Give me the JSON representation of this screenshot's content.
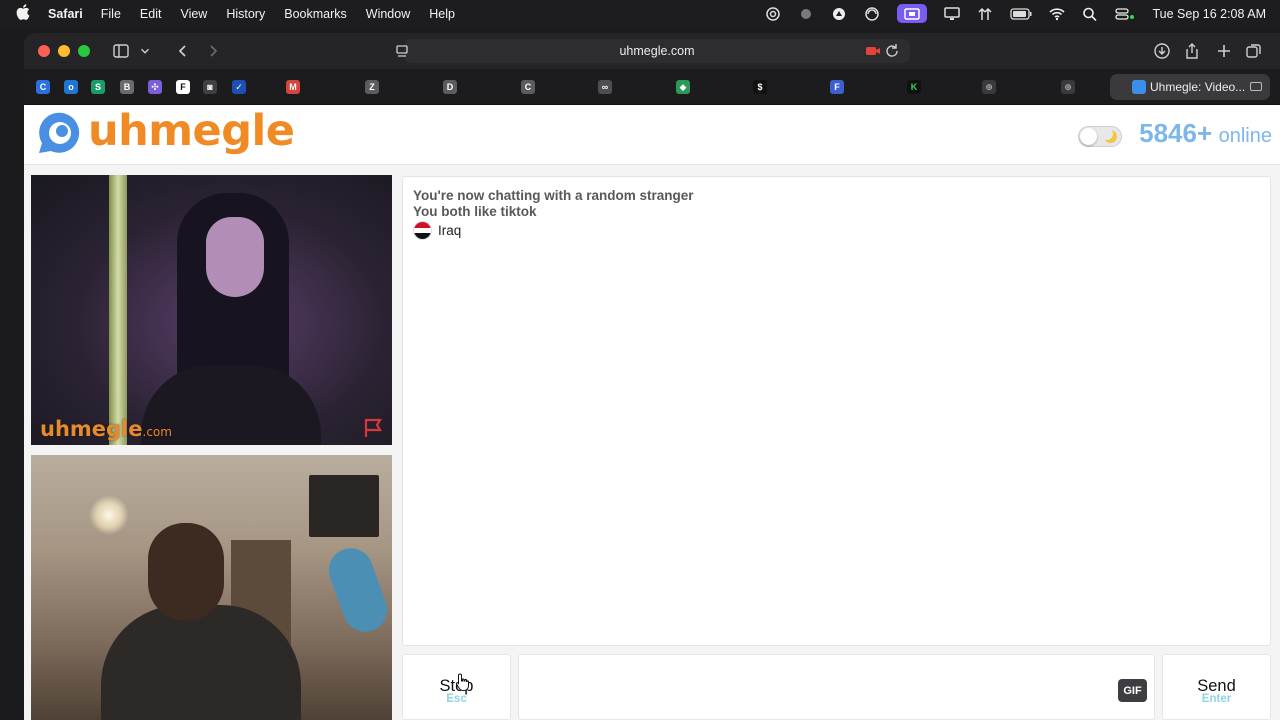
{
  "menubar": {
    "app_name": "Safari",
    "menus": [
      "File",
      "Edit",
      "View",
      "History",
      "Bookmarks",
      "Window",
      "Help"
    ],
    "clock": "Tue Sep 16  2:08 AM",
    "status_icons": [
      "creative-cloud-icon",
      "record-dot-icon",
      "drive-icon",
      "sync-icon",
      "screen-share-icon",
      "display-icon",
      "arrows-icon",
      "battery-icon",
      "wifi-icon",
      "spotlight-search-icon",
      "control-center-icon"
    ],
    "active_color": "#7b5cf3"
  },
  "browser": {
    "url": "uhmegle.com",
    "active_tab_title": "Uhmegle: Video...",
    "bookmark_favicons": [
      {
        "name": "c-favicon",
        "letter": "C",
        "color": "#2d6fe0"
      },
      {
        "name": "outlook-favicon",
        "letter": "o",
        "color": "#1f75d4"
      },
      {
        "name": "s-favicon",
        "letter": "S",
        "color": "#1a9d6b"
      },
      {
        "name": "b-favicon",
        "letter": "B",
        "color": "#6a6a6e"
      },
      {
        "name": "grid-favicon",
        "letter": "✣",
        "color": "#7a5fd8"
      },
      {
        "name": "f-favicon",
        "letter": "F",
        "color": "#ffffff"
      },
      {
        "name": "camera-favicon",
        "letter": "◙",
        "color": "#404044"
      },
      {
        "name": "blue-check-favicon",
        "letter": "✓",
        "color": "#1e4fb3"
      },
      {
        "name": "gmail-favicon",
        "letter": "M",
        "color": "#d6453b"
      },
      {
        "name": "z-favicon",
        "letter": "Z",
        "color": "#5c5c60"
      },
      {
        "name": "d-favicon",
        "letter": "D",
        "color": "#5c5c60"
      },
      {
        "name": "c2-favicon",
        "letter": "C",
        "color": "#5c5c60"
      },
      {
        "name": "link-favicon",
        "letter": "∞",
        "color": "#4d4d52"
      },
      {
        "name": "green-favicon",
        "letter": "◆",
        "color": "#2c9a57"
      },
      {
        "name": "dollar-favicon",
        "letter": "$",
        "color": "#111111"
      },
      {
        "name": "blue-f-favicon",
        "letter": "F",
        "color": "#3c5fd0"
      },
      {
        "name": "kick-favicon",
        "letter": "K",
        "color": "#111111"
      },
      {
        "name": "globe-favicon",
        "letter": "⊕",
        "color": "#3a3a3e"
      },
      {
        "name": "globe2-favicon",
        "letter": "⊕",
        "color": "#3a3a3e"
      }
    ]
  },
  "site": {
    "logo_text": "uhmegle",
    "online_count": "5846+",
    "online_label": "online",
    "brand_color": "#f08a24",
    "online_color": "#7db6ea"
  },
  "video": {
    "watermark": "uhmegle",
    "watermark_suffix": ".com"
  },
  "chat": {
    "status_line": "You're now chatting with a random stranger",
    "interest_line": "You both like tiktok",
    "country": "Iraq"
  },
  "controls": {
    "stop_label": "Stop",
    "stop_key": "Esc",
    "gif_label": "GIF",
    "send_label": "Send",
    "send_key": "Enter",
    "key_hint_color": "#8fd3e6"
  }
}
